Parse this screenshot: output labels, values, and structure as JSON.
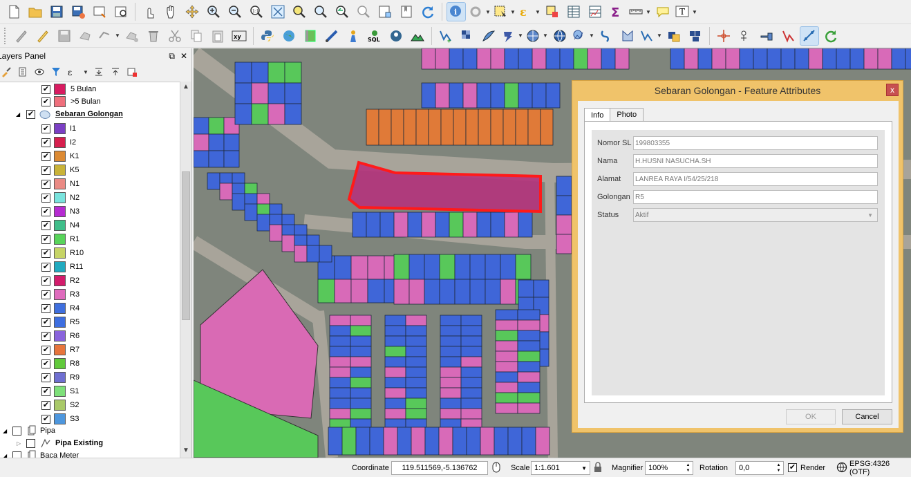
{
  "layers_panel": {
    "title": "Layers Panel",
    "float_btn": "⧉",
    "close_btn": "✕",
    "items": [
      {
        "label": "5 Bulan",
        "color": "#d81b60"
      },
      {
        "label": ">5 Bulan",
        "color": "#ef6f7c"
      }
    ],
    "group": {
      "label": "Sebaran Golongan"
    },
    "classes": [
      {
        "label": "I1",
        "color": "#7b3fc4"
      },
      {
        "label": "I2",
        "color": "#d61f4d"
      },
      {
        "label": "K1",
        "color": "#dc8a33"
      },
      {
        "label": "K5",
        "color": "#c9b338"
      },
      {
        "label": "N1",
        "color": "#ea8a84"
      },
      {
        "label": "N2",
        "color": "#79e3dd"
      },
      {
        "label": "N3",
        "color": "#b52bd1"
      },
      {
        "label": "N4",
        "color": "#3fbe8a"
      },
      {
        "label": "R1",
        "color": "#58d45a"
      },
      {
        "label": "R10",
        "color": "#c6d466"
      },
      {
        "label": "R11",
        "color": "#21aabf"
      },
      {
        "label": "R2",
        "color": "#d31c6b"
      },
      {
        "label": "R3",
        "color": "#df6bbd"
      },
      {
        "label": "R4",
        "color": "#3f6fde"
      },
      {
        "label": "R5",
        "color": "#3d6ee0"
      },
      {
        "label": "R6",
        "color": "#8963dc"
      },
      {
        "label": "R7",
        "color": "#e7753c"
      },
      {
        "label": "R8",
        "color": "#61c93b"
      },
      {
        "label": "R9",
        "color": "#6f6fd1"
      },
      {
        "label": "S1",
        "color": "#7ee07a"
      },
      {
        "label": "S2",
        "color": "#a9c968"
      },
      {
        "label": "S3",
        "color": "#4e97de"
      }
    ],
    "pipa": {
      "label": "Pipa"
    },
    "pipa_existing": {
      "label": "Pipa Existing"
    },
    "baca_meter": {
      "label": "Baca Meter"
    }
  },
  "dialog": {
    "title": "Sebaran Golongan - Feature Attributes",
    "close": "x",
    "tabs": {
      "info": "Info",
      "photo": "Photo"
    },
    "fields": {
      "nomor_sl": {
        "label": "Nomor SL",
        "value": "199803355"
      },
      "nama": {
        "label": "Nama",
        "value": "H.HUSNI NASUCHA.SH"
      },
      "alamat": {
        "label": "Alamat",
        "value": "LANREA RAYA I/54/25/218"
      },
      "golongan": {
        "label": "Golongan",
        "value": "R5"
      },
      "status": {
        "label": "Status",
        "value": "Aktif"
      }
    },
    "ok": "OK",
    "cancel": "Cancel"
  },
  "statusbar": {
    "coordinate_label": "Coordinate",
    "coordinate_value": "119.511569,-5.136762",
    "scale_label": "Scale",
    "scale_value": "1:1.601",
    "magnifier_label": "Magnifier",
    "magnifier_value": "100%",
    "rotation_label": "Rotation",
    "rotation_value": "0,0",
    "render_label": "Render",
    "crs": "EPSG:4326 (OTF)"
  },
  "toolbar_icons_row1": [
    "new-project-icon",
    "open-project-icon",
    "save-project-icon",
    "save-as-icon",
    "new-print-composer-icon",
    "composer-manager-icon",
    "touch-icon",
    "pan-icon",
    "pan-to-selection-icon",
    "zoom-in-icon",
    "zoom-out-icon",
    "zoom-native-icon",
    "zoom-full-icon",
    "zoom-to-selection-icon",
    "zoom-to-layer-icon",
    "zoom-last-icon",
    "zoom-next-icon",
    "new-map-view-icon",
    "new-bookmark-icon",
    "refresh-icon",
    "identify-icon",
    "action-icon",
    "select-feature-icon",
    "select-by-expression-icon",
    "deselect-icon",
    "attribute-table-icon",
    "field-calculator-icon",
    "statistics-icon",
    "measure-icon",
    "map-tips-icon",
    "text-annotation-icon"
  ],
  "toolbar_icons_row2": [
    "current-edits-icon",
    "toggle-editing-icon",
    "save-edits-icon",
    "add-feature-icon",
    "move-feature-icon",
    "node-tool-icon",
    "delete-selected-icon",
    "cut-features-icon",
    "copy-features-icon",
    "paste-features-icon",
    "xy-tool-icon",
    "python-icon",
    "globe-icon",
    "raster-icon",
    "measure-line-icon",
    "georef-icon",
    "sql-icon",
    "postgis-icon",
    "dem-icon",
    "add-vector-icon",
    "add-raster-icon",
    "add-wms-icon",
    "add-wcs-icon",
    "add-wfs-icon",
    "add-delimited-icon",
    "add-virtual-icon",
    "new-shapefile-icon",
    "new-spatialite-icon",
    "digitize-icon",
    "snap-icon",
    "reshape-icon",
    "split-icon",
    "merge-icon",
    "rotate-icon",
    "offset-icon",
    "trace-icon",
    "settings-icon",
    "processing-icon"
  ]
}
